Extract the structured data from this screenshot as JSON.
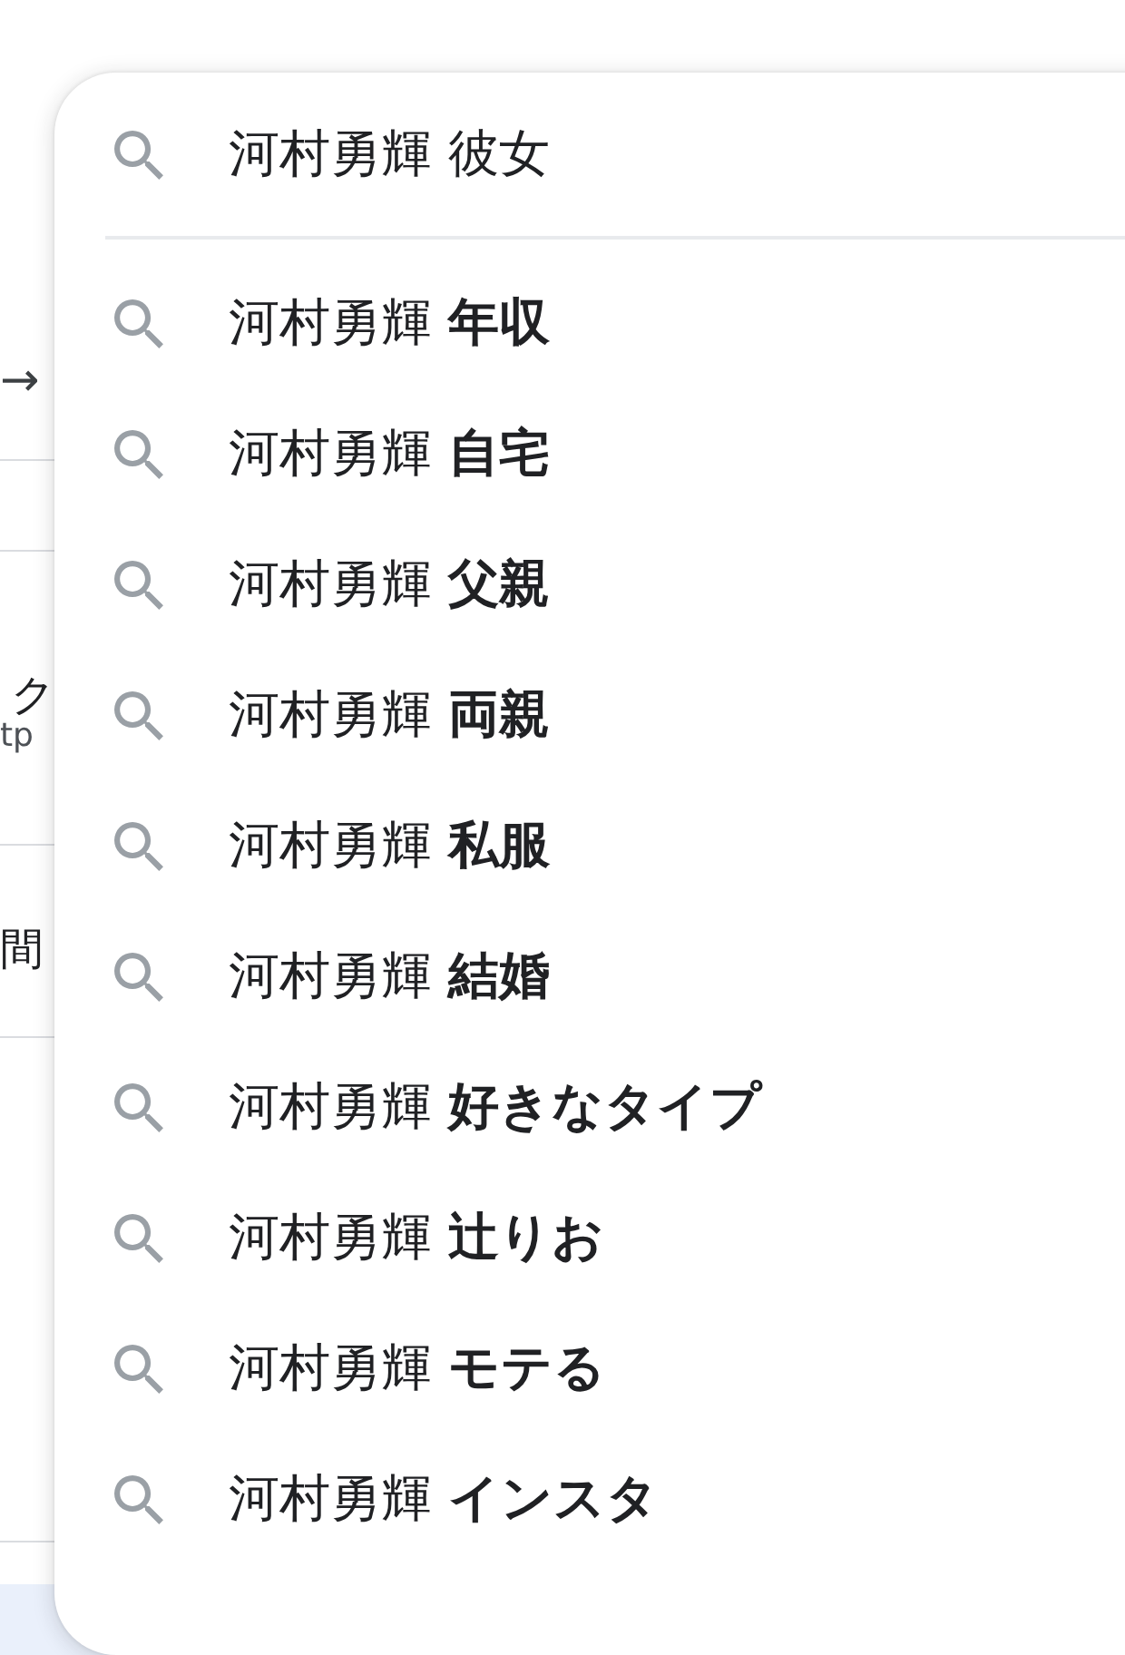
{
  "background_page": {
    "fragments": [
      {
        "kind": "arrow",
        "text": "→"
      },
      {
        "kind": "title",
        "text": "ク"
      },
      {
        "kind": "url",
        "text": "tp"
      },
      {
        "kind": "title",
        "text": "間"
      }
    ]
  },
  "search": {
    "value": "河村勇輝 彼女"
  },
  "suggestions": [
    {
      "text": "河村勇輝 **年収**"
    },
    {
      "text": "河村勇輝 **自宅**"
    },
    {
      "text": "河村勇輝 **父親**"
    },
    {
      "text": "河村勇輝 **両親**"
    },
    {
      "text": "河村勇輝 **私服**"
    },
    {
      "text": "河村勇輝 **結婚**"
    },
    {
      "text": "河村勇輝 **好きなタイプ**"
    },
    {
      "text": "河村勇輝 **辻りお**"
    },
    {
      "text": "河村勇輝 **モテる**"
    },
    {
      "text": "河村勇輝 **インスタ**"
    }
  ]
}
